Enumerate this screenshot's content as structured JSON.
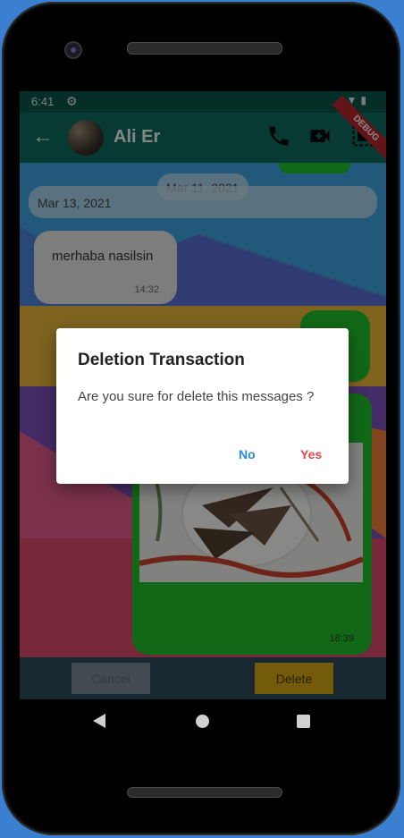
{
  "status": {
    "time": "6:41"
  },
  "appbar": {
    "contact_name": "Ali Er",
    "debug_label": "DEBUG"
  },
  "dates": {
    "first": "Mar 11, 2021",
    "second": "Mar 13, 2021"
  },
  "messages": {
    "incoming_text": "merhaba nasilsin",
    "incoming_time": "14:32",
    "outgoing_time": "18:39"
  },
  "dialog": {
    "title": "Deletion Transaction",
    "question": "Are you sure for delete this messages ?",
    "no_label": "No",
    "yes_label": "Yes"
  },
  "actions": {
    "cancel_label": "Cancel",
    "delete_label": "Delete"
  },
  "colors": {
    "appbar": "#0b6b5c",
    "bubble_out": "#1fbf2a",
    "delete_button": "#d4a414",
    "no_button": "#2a8ad8",
    "yes_button": "#e04848"
  }
}
